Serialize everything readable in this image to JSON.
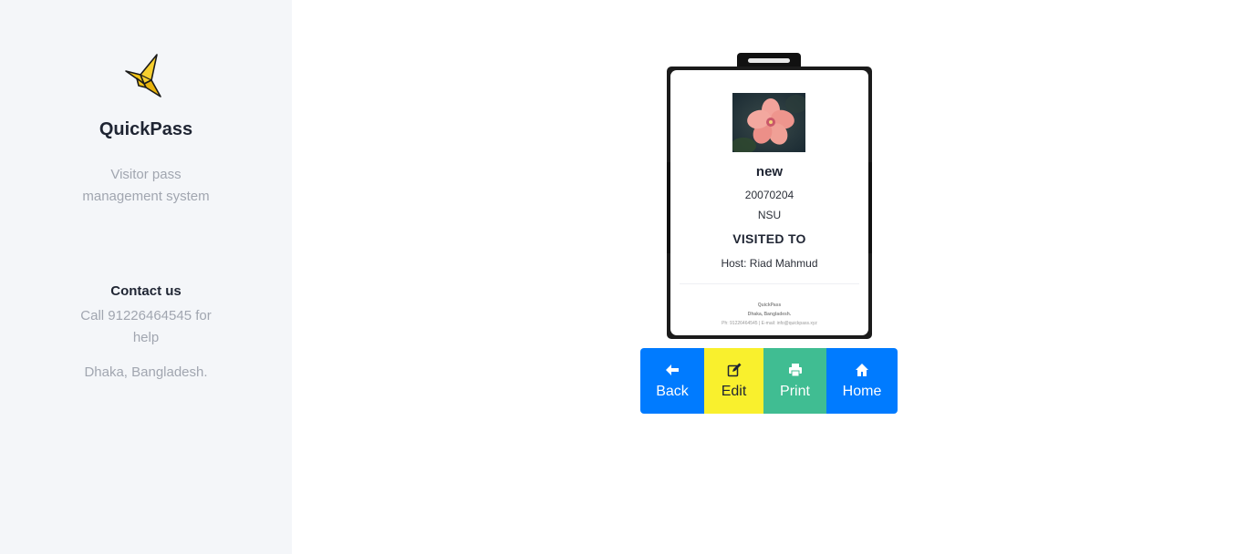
{
  "sidebar": {
    "logo_icon": "origami-bird-icon",
    "brand": "QuickPass",
    "tagline": "Visitor pass management system",
    "contact_title": "Contact us",
    "contact_phone": "Call 91226464545 for help",
    "contact_address": "Dhaka, Bangladesh."
  },
  "badge": {
    "photo_icon": "visitor-photo",
    "visitor_name": "new",
    "visitor_id": "20070204",
    "visitor_org": "NSU",
    "visited_label": "VISITED TO",
    "host": "Host: Riad Mahmud",
    "footer_brand": "QuickPass",
    "footer_address": "Dhaka, Bangladesh.",
    "footer_contact": "Ph: 91226464545 | E-mail: info@quickpass.xyz"
  },
  "buttons": {
    "back": {
      "label": "Back",
      "icon": "arrow-left-icon"
    },
    "edit": {
      "label": "Edit",
      "icon": "edit-icon"
    },
    "print": {
      "label": "Print",
      "icon": "printer-icon"
    },
    "home": {
      "label": "Home",
      "icon": "home-icon"
    }
  },
  "colors": {
    "sidebar_bg": "#f4f6f9",
    "primary": "#007bff",
    "edit": "#f9f02d",
    "print": "#40bd92"
  }
}
